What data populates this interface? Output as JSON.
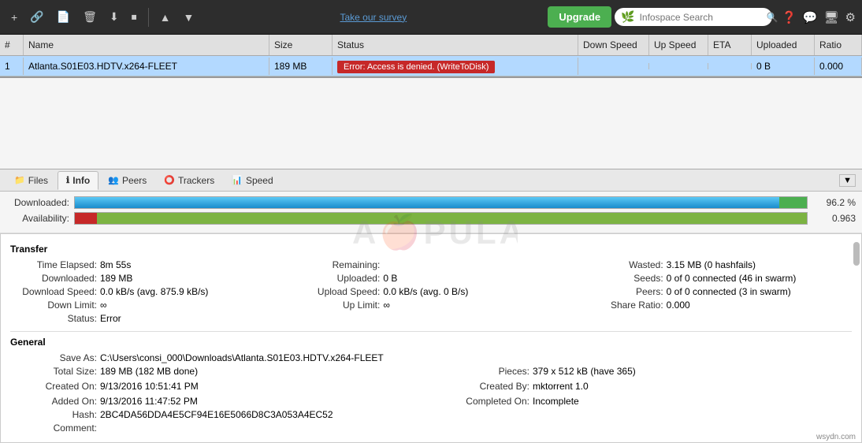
{
  "toolbar": {
    "survey_link": "Take our survey",
    "upgrade_label": "Upgrade",
    "search_placeholder": "Infospace Search",
    "icons": {
      "add": "+",
      "link": "🔗",
      "file": "📄",
      "delete": "🗑",
      "download": "⬇",
      "pause": "⏸",
      "up": "▲",
      "down": "▼"
    }
  },
  "table": {
    "headers": [
      "#",
      "Name",
      "Size",
      "Status",
      "Down Speed",
      "Up Speed",
      "ETA",
      "Uploaded",
      "Ratio"
    ],
    "rows": [
      {
        "num": "1",
        "name": "Atlanta.S01E03.HDTV.x264-FLEET",
        "size": "189 MB",
        "status": "Error: Access is denied.  (WriteToDisk)",
        "down_speed": "",
        "up_speed": "",
        "eta": "",
        "uploaded": "0 B",
        "ratio": "0.000"
      }
    ]
  },
  "tabs": [
    {
      "id": "files",
      "label": "Files",
      "icon": "📁"
    },
    {
      "id": "info",
      "label": "Info",
      "icon": "ℹ",
      "active": true
    },
    {
      "id": "peers",
      "label": "Peers",
      "icon": "👥"
    },
    {
      "id": "trackers",
      "label": "Trackers",
      "icon": "⭕"
    },
    {
      "id": "speed",
      "label": "Speed",
      "icon": "📊"
    }
  ],
  "progress": {
    "downloaded_label": "Downloaded:",
    "downloaded_value": "96.2 %",
    "availability_label": "Availability:",
    "availability_value": "0.963"
  },
  "transfer": {
    "title": "Transfer",
    "time_elapsed_label": "Time Elapsed:",
    "time_elapsed_val": "8m 55s",
    "downloaded_label": "Downloaded:",
    "downloaded_val": "189 MB",
    "download_speed_label": "Download Speed:",
    "download_speed_val": "0.0 kB/s (avg. 875.9 kB/s)",
    "down_limit_label": "Down Limit:",
    "down_limit_val": "∞",
    "status_label": "Status:",
    "status_val": "Error",
    "remaining_label": "Remaining:",
    "remaining_val": "",
    "uploaded_label": "Uploaded:",
    "uploaded_val": "0 B",
    "upload_speed_label": "Upload Speed:",
    "upload_speed_val": "0.0 kB/s (avg. 0 B/s)",
    "up_limit_label": "Up Limit:",
    "up_limit_val": "∞",
    "wasted_label": "Wasted:",
    "wasted_val": "3.15 MB (0 hashfails)",
    "seeds_label": "Seeds:",
    "seeds_val": "0 of 0 connected (46 in swarm)",
    "peers_label": "Peers:",
    "peers_val": "0 of 0 connected (3 in swarm)",
    "share_ratio_label": "Share Ratio:",
    "share_ratio_val": "0.000"
  },
  "general": {
    "title": "General",
    "save_as_label": "Save As:",
    "save_as_val": "C:\\Users\\consi_000\\Downloads\\Atlanta.S01E03.HDTV.x264-FLEET",
    "total_size_label": "Total Size:",
    "total_size_val": "189 MB (182 MB done)",
    "created_on_label": "Created On:",
    "created_on_val": "9/13/2016 10:51:41 PM",
    "added_on_label": "Added On:",
    "added_on_val": "9/13/2016 11:47:52 PM",
    "hash_label": "Hash:",
    "hash_val": "2BC4DA56DDA4E5CF94E16E5066D8C3A053A4EC52",
    "comment_label": "Comment:",
    "comment_val": "",
    "pieces_label": "Pieces:",
    "pieces_val": "379 x 512 kB (have 365)",
    "created_by_label": "Created By:",
    "created_by_val": "mktorrent 1.0",
    "completed_on_label": "Completed On:",
    "completed_on_val": "Incomplete"
  },
  "watermark": "A  PULAS",
  "bottom_watermark": "wsydn.com"
}
